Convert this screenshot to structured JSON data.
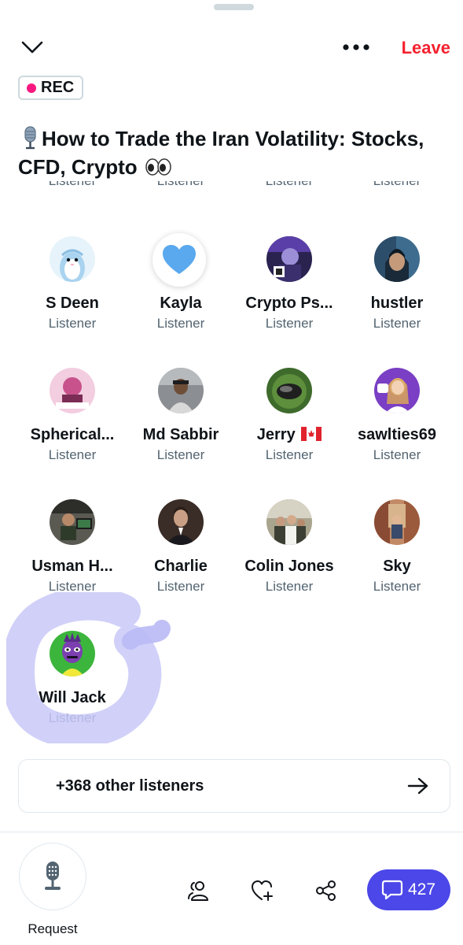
{
  "header": {
    "leave_label": "Leave",
    "rec_label": "REC"
  },
  "space": {
    "title_line1": "How to Trade the Iran Volatility: Stocks,",
    "title_line2": "CFD, Crypto"
  },
  "clipped_row": [
    "Listener",
    "Listener",
    "Listener",
    "Listener"
  ],
  "participants": [
    {
      "name": "S Deen",
      "role": "Listener"
    },
    {
      "name": "Kayla",
      "role": "Listener"
    },
    {
      "name": "Crypto Ps...",
      "role": "Listener"
    },
    {
      "name": "hustler",
      "role": "Listener"
    },
    {
      "name": "Spherical...",
      "role": "Listener"
    },
    {
      "name": "Md Sabbir",
      "role": "Listener"
    },
    {
      "name": "Jerry",
      "role": "Listener"
    },
    {
      "name": "sawlties69",
      "role": "Listener"
    },
    {
      "name": "Usman H...",
      "role": "Listener"
    },
    {
      "name": "Charlie",
      "role": "Listener"
    },
    {
      "name": "Colin Jones",
      "role": "Listener"
    },
    {
      "name": "Sky",
      "role": "Listener"
    },
    {
      "name": "Will Jack",
      "role": "Listener"
    }
  ],
  "other_listeners_label": "+368 other listeners",
  "bottom_bar": {
    "request_label": "Request",
    "chat_count": "427"
  },
  "colors": {
    "leave": "#f4212e",
    "rec_dot": "#f91880",
    "chat_button": "#4b47e8",
    "highlight": "#c8c8f8"
  }
}
